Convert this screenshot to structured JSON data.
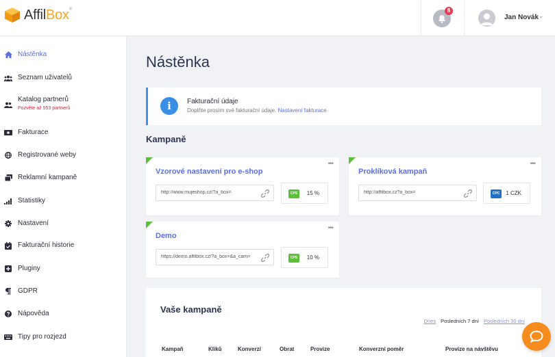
{
  "brand": {
    "name_part1": "Affil",
    "name_part2": "Box",
    "mark": "®"
  },
  "header": {
    "notifications_count": "8",
    "user_name": "Jan Novák"
  },
  "sidebar": {
    "items": [
      {
        "label": "Nástěnka",
        "icon": "home-icon",
        "active": true
      },
      {
        "label": "Seznam uživatelů",
        "icon": "users-icon"
      },
      {
        "label": "Katalog partnerů",
        "sub": "Pozvěte až 553 partnerů",
        "icon": "partners-icon"
      },
      {
        "label": "Fakturace",
        "icon": "invoice-icon"
      },
      {
        "label": "Registrované weby",
        "icon": "globe-icon"
      },
      {
        "label": "Reklamní kampaně",
        "icon": "campaigns-icon"
      },
      {
        "label": "Statistiky",
        "icon": "stats-icon"
      },
      {
        "label": "Nastavení",
        "icon": "gear-icon"
      },
      {
        "label": "Fakturační historie",
        "icon": "calendar-icon"
      },
      {
        "label": "Pluginy",
        "icon": "plus-square-icon"
      },
      {
        "label": "GDPR",
        "icon": "paragraph-icon"
      },
      {
        "label": "Nápověda",
        "icon": "help-icon"
      },
      {
        "label": "Tipy pro rozjezd",
        "icon": "keyboard-icon"
      }
    ]
  },
  "main": {
    "title": "Nástěnka",
    "info": {
      "title": "Fakturační údaje",
      "desc": "Doplňte prosím své fakturační údaje.",
      "link": "Nastavení fakturace"
    },
    "campaigns_title": "Kampaně",
    "campaigns": [
      {
        "title": "Vzorové nastavení pro e-shop",
        "url": "http://www.mujeshop.cz/?a_box=",
        "type": "CPS",
        "type_color": "#5bbf3a",
        "value": "15 %"
      },
      {
        "title": "Proklíková kampaň",
        "url": "http://affilbox.cz?a_box=",
        "type": "CPC",
        "type_color": "#1f72c8",
        "value": "1 CZK"
      },
      {
        "title": "Demo",
        "url": "https://demo.affilbox.cz/?a_box=&a_cam=",
        "type": "CPS",
        "type_color": "#5bbf3a",
        "value": "10 %"
      }
    ],
    "your_campaigns": {
      "title": "Vaše kampaně",
      "filters": {
        "today": "Dnes",
        "last7": "Posledních 7 dní",
        "last30": "Posledních 30 dní"
      },
      "columns": [
        "Kampaň",
        "Kliků",
        "Konverzí",
        "Obrat",
        "Provize",
        "Konverzní poměr",
        "Provize na návštěvu"
      ]
    }
  }
}
